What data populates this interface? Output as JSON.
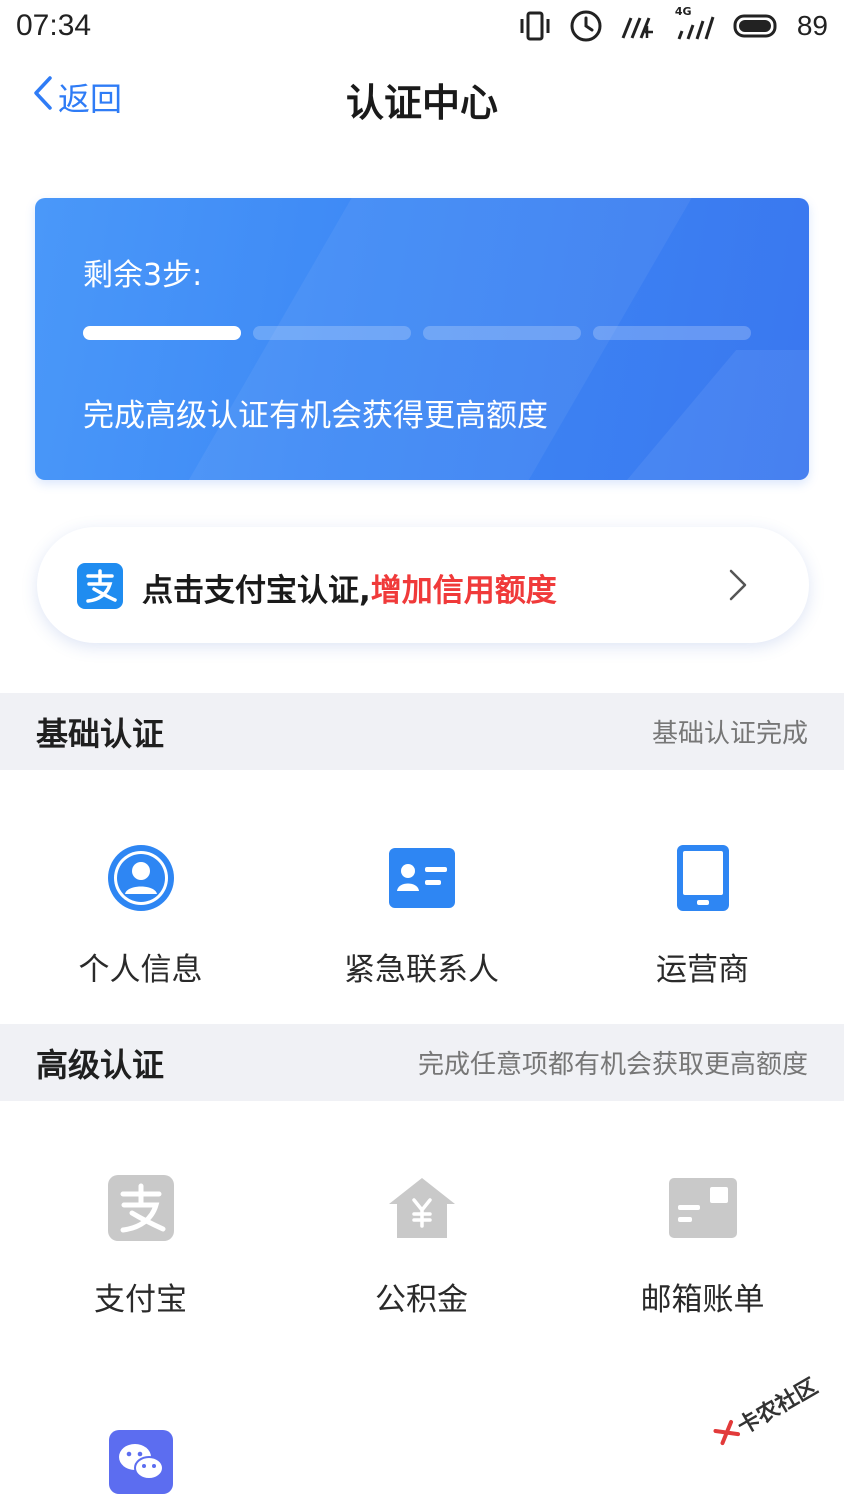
{
  "status_bar": {
    "time": "07:34",
    "network": "4G",
    "battery": "89"
  },
  "nav": {
    "back_label": "返回",
    "title": "认证中心"
  },
  "progress_card": {
    "steps_label": "剩余3步:",
    "segments_total": 4,
    "segments_done": 1,
    "description": "完成高级认证有机会获得更高额度"
  },
  "alipay_banner": {
    "text": "点击支付宝认证,",
    "highlight": "增加信用额度",
    "icon": "alipay-icon",
    "highlight_color": "#f03a3a"
  },
  "basic_section": {
    "title": "基础认证",
    "status": "基础认证完成",
    "items": [
      {
        "label": "个人信息",
        "icon": "person-icon"
      },
      {
        "label": "紧急联系人",
        "icon": "contact-card-icon"
      },
      {
        "label": "运营商",
        "icon": "phone-icon"
      }
    ]
  },
  "advanced_section": {
    "title": "高级认证",
    "note": "完成任意项都有机会获取更高额度",
    "items": [
      {
        "label": "支付宝",
        "icon": "alipay-icon"
      },
      {
        "label": "公积金",
        "icon": "housing-fund-icon"
      },
      {
        "label": "邮箱账单",
        "icon": "email-bill-icon"
      },
      {
        "label": "",
        "icon": "wechat-icon"
      }
    ]
  },
  "watermark": {
    "text": "卡农社区"
  },
  "colors": {
    "accent": "#2f7cf6",
    "card_gradient_start": "#4a98f9",
    "card_gradient_end": "#3a77ef",
    "section_bg": "#f0f1f5",
    "inactive_icon": "#c9c9c9",
    "wechat": "#5c6df0"
  }
}
